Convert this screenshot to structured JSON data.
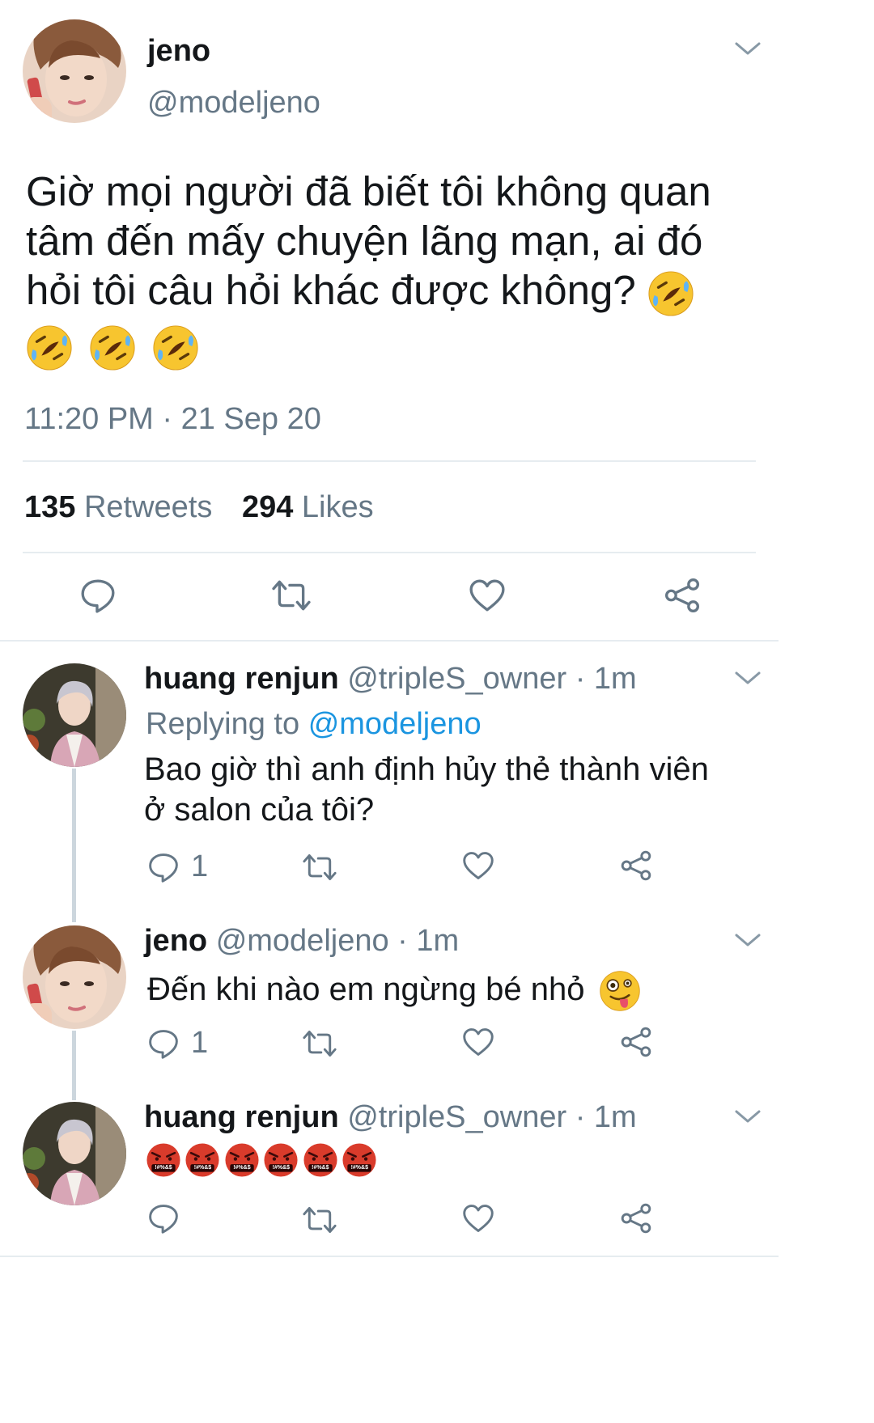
{
  "main_tweet": {
    "author_name": "jeno",
    "author_handle": "@modeljeno",
    "text_lines": [
      "Giờ mọi người đã biết tôi không quan",
      "tâm đến mấy chuyện lãng mạn, ai đó",
      "hỏi tôi câu hỏi khác được không?"
    ],
    "emoji_name": "rolling-on-floor-laughing-emoji",
    "timestamp": "11:20 PM · 21 Sep 20",
    "retweets_count": "135",
    "retweets_label": "Retweets",
    "likes_count": "294",
    "likes_label": "Likes"
  },
  "replies": [
    {
      "author_name": "huang renjun",
      "author_handle": "@tripleS_owner",
      "time": "· 1m",
      "replying_label": "Replying to",
      "replying_handle": "@modeljeno",
      "text_lines": [
        "Bao giờ thì anh định hủy thẻ thành viên",
        "ở salon của tôi?"
      ],
      "reply_count": "1"
    },
    {
      "author_name": "jeno",
      "author_handle": "@modeljeno",
      "time": "· 1m",
      "text": "Đến khi nào em ngừng bé nhỏ",
      "emoji_name": "zany-face-emoji",
      "reply_count": "1"
    },
    {
      "author_name": "huang renjun",
      "author_handle": "@tripleS_owner",
      "time": "· 1m",
      "emoji_name": "face-with-symbols-on-mouth-emoji",
      "emoji_symbols": "!#%&$"
    }
  ],
  "colors": {
    "text": "#14171a",
    "muted": "#657786",
    "link": "#1b95e0",
    "divider": "#e6ecf0",
    "emoji_yellow": "#f7c52f",
    "emoji_red": "#d93b2b"
  }
}
